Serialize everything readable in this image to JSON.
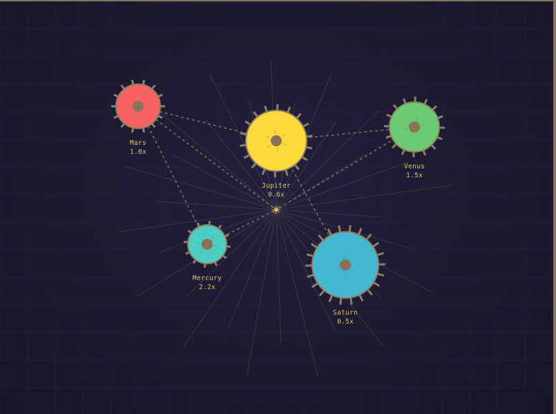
{
  "colors": {
    "background": "#1c1a30",
    "grid": "#2a2846",
    "frame": "#8a7558",
    "tooth": "#8f7f66",
    "hub": "#8a7158",
    "rim": "#8f7f66",
    "link": "#a08a60",
    "ray": "#c8b47a",
    "label": "#e0c46a"
  },
  "gears": [
    {
      "id": "mars",
      "name": "Mars",
      "speed": "1.0x",
      "color": "#f76262",
      "icon": "gear-icon"
    },
    {
      "id": "jupiter",
      "name": "Jupiter",
      "speed": "0.6x",
      "color": "#fdd93d",
      "icon": "gear-icon"
    },
    {
      "id": "venus",
      "name": "Venus",
      "speed": "1.5x",
      "color": "#6bcb72",
      "icon": "gear-icon"
    },
    {
      "id": "mercury",
      "name": "Mercury",
      "speed": "2.2x",
      "color": "#4ecdc4",
      "icon": "gear-icon"
    },
    {
      "id": "saturn",
      "name": "Saturn",
      "speed": "0.5x",
      "color": "#45b7d1",
      "icon": "gear-icon"
    }
  ],
  "links": [
    [
      "mars",
      "jupiter"
    ],
    [
      "jupiter",
      "venus"
    ],
    [
      "mars",
      "mercury"
    ],
    [
      "jupiter",
      "saturn"
    ],
    [
      "mars",
      "center"
    ],
    [
      "venus",
      "center"
    ],
    [
      "mercury",
      "center"
    ]
  ],
  "center_icon": "sun-icon"
}
